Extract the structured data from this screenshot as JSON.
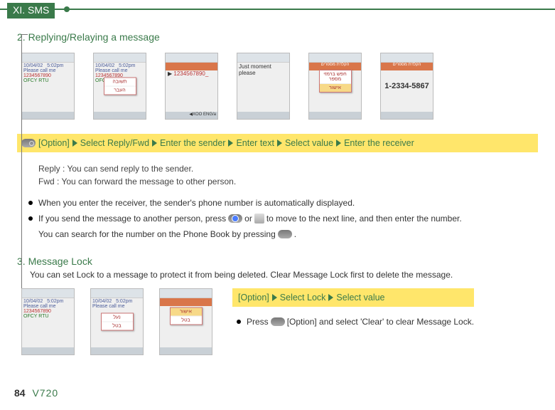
{
  "header": {
    "section_tab": "XI. SMS"
  },
  "section2": {
    "title": "2. Replying/Relaying a message",
    "screens": {
      "date": "10/04/02",
      "time": "5:02pm",
      "line2": "Please call me",
      "line3": "1234567890",
      "line4": "OFCY RTU",
      "popup1_1": "תשובה",
      "popup1_2": "העבר",
      "s3_number": "1234567890_",
      "s3_keypad": "◀XOO ENG/a",
      "s4_text": "Just moment please",
      "s5_header": "הקלדת מספרים",
      "s5_popup": "חפש ברמזי מספר",
      "s6_header": "הקלדת מספרים",
      "s6_number": "1-2334-5867",
      "ok": "אישור"
    },
    "yellowbar": {
      "option": "[Option]",
      "step1": "Select Reply/Fwd",
      "step2": "Enter the sender",
      "step3": "Enter text",
      "step4": "Select value",
      "step5": "Enter the receiver"
    },
    "notes": {
      "reply": "Reply : You can send reply to the sender.",
      "fwd": "Fwd : You can forward the message to other person."
    },
    "bullets": {
      "b1": "When you enter the receiver, the sender's phone number is automatically displayed.",
      "b2a": "If you send the message to another person, press",
      "b2b": "or",
      "b2c": "to move to the next line, and then enter the number.",
      "b3a": "You can search for the number on the Phone Book by pressing",
      "b3b": "."
    }
  },
  "section3": {
    "title": "3. Message Lock",
    "desc": "You can set Lock to a message to protect it from being deleted. Clear Message Lock first to delete the message.",
    "yellowbar": {
      "option": "[Option]",
      "step1": "Select Lock",
      "step2": "Select value"
    },
    "press": {
      "a": "Press",
      "b": "[Option] and select 'Clear' to clear Message Lock."
    },
    "popup": {
      "l1": "נעל",
      "l2": "בטל"
    }
  },
  "footer": {
    "page": "84",
    "model": "V720"
  }
}
